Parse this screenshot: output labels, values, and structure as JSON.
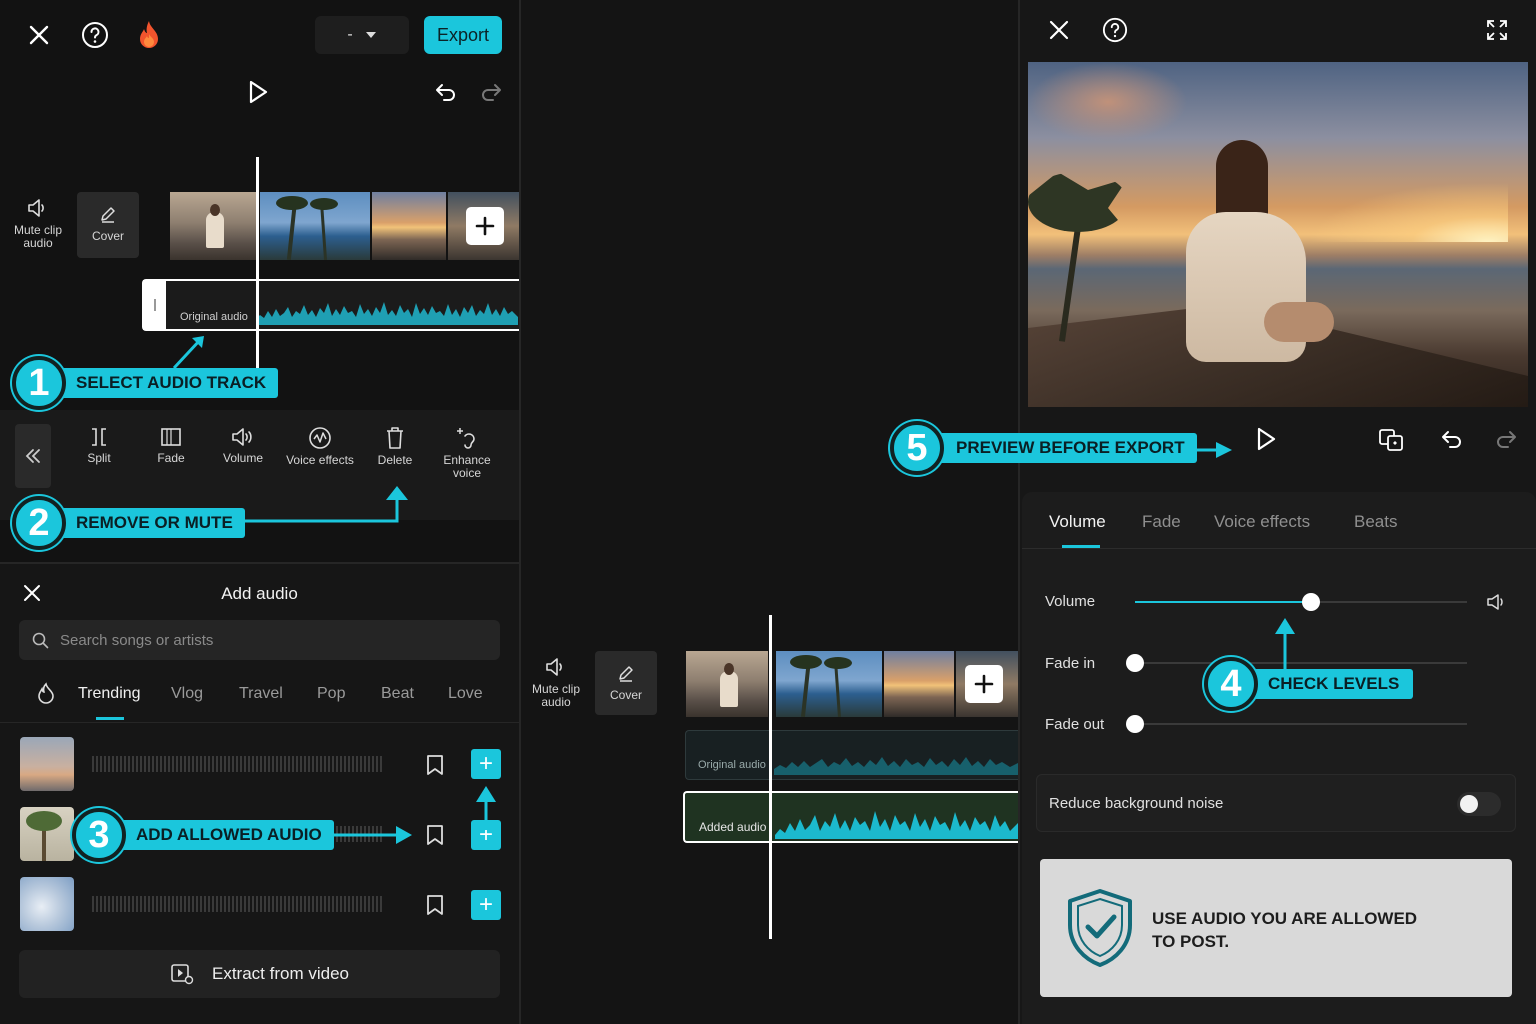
{
  "left_panel": {
    "export_label": "Export",
    "resolution_value": "-",
    "side_tools": {
      "mute_label": "Mute clip audio",
      "cover_label": "Cover"
    },
    "original_audio_label": "Original audio",
    "toolbar": [
      {
        "label": "Split",
        "icon": "split-icon"
      },
      {
        "label": "Fade",
        "icon": "fade-icon"
      },
      {
        "label": "Volume",
        "icon": "volume-icon"
      },
      {
        "label": "Voice effects",
        "icon": "voice-effects-icon"
      },
      {
        "label": "Delete",
        "icon": "delete-icon"
      },
      {
        "label": "Enhance voice",
        "icon": "enhance-voice-icon"
      }
    ]
  },
  "callouts": {
    "step1": {
      "num": "1",
      "text": "SELECT AUDIO TRACK"
    },
    "step2": {
      "num": "2",
      "text": "REMOVE OR MUTE"
    },
    "step3": {
      "num": "3",
      "text": "ADD ALLOWED AUDIO"
    },
    "step4": {
      "num": "4",
      "text": "CHECK LEVELS"
    },
    "step5": {
      "num": "5",
      "text": "PREVIEW BEFORE EXPORT"
    }
  },
  "add_audio": {
    "title": "Add audio",
    "search_placeholder": "Search songs or artists",
    "tabs": [
      "Trending",
      "Vlog",
      "Travel",
      "Pop",
      "Beat",
      "Love"
    ],
    "active_tab": "Trending",
    "extract_label": "Extract from video"
  },
  "middle_panel": {
    "mute_label": "Mute clip audio",
    "cover_label": "Cover",
    "original_audio_label": "Original audio",
    "added_audio_label": "Added audio"
  },
  "right_panel": {
    "tabs": [
      "Volume",
      "Fade",
      "Voice effects",
      "Beats"
    ],
    "active_tab": "Volume",
    "sliders": [
      {
        "label": "Volume",
        "level": 0.53
      },
      {
        "label": "Fade in",
        "level": 0
      },
      {
        "label": "Fade out",
        "level": 0
      }
    ],
    "noise_label": "Reduce background noise",
    "noise_enabled": false,
    "notice": "USE AUDIO YOU ARE ALLOWED TO POST.",
    "colors": {
      "accent": "#1bc6dc",
      "notice_bg": "#d9d9d9",
      "shield": "#136b7a"
    }
  }
}
